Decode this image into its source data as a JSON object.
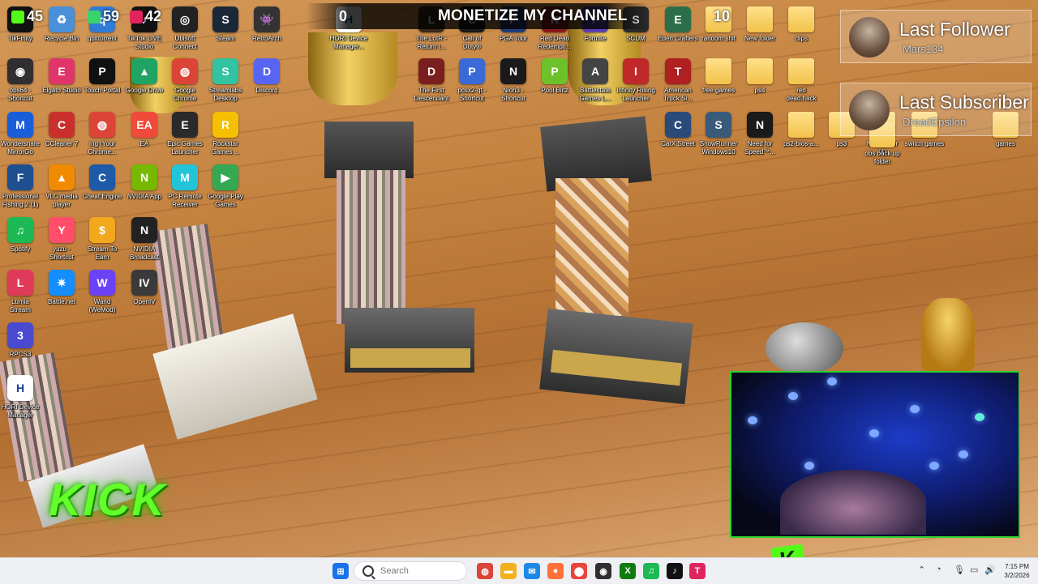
{
  "overlay": {
    "stats": [
      {
        "label": "Kick",
        "value": "45",
        "color": "#53fc18"
      },
      {
        "label": "Viewers",
        "value": "59",
        "color": "#3ad36a"
      },
      {
        "label": "Chat",
        "value": "42",
        "color": "#e0245e"
      }
    ],
    "banner_left_count": "0",
    "banner_title": "MONETIZE MY CHANNEL",
    "banner_right_count": "10",
    "last_follower": {
      "title": "Last Follower",
      "name": "Mars134"
    },
    "last_subscriber": {
      "title": "Last Subscriber",
      "name": "DreadEpsilon"
    },
    "kick_logo": "KICK",
    "kick_badge": "K"
  },
  "desktop": {
    "icons": [
      {
        "id": "tikfinity",
        "label": "TikFinity",
        "label2": "",
        "glyph": "T",
        "color": "#111111"
      },
      {
        "id": "recycle-bin",
        "label": "Recycle Bin",
        "label2": "",
        "glyph": "♻",
        "color": "#4a90d9"
      },
      {
        "id": "qbittorrent",
        "label": "qbittorrent",
        "label2": "",
        "glyph": "q",
        "color": "#2f7bd6"
      },
      {
        "id": "tiktok-live-studio",
        "label": "TikTok LIVE",
        "label2": "Studio",
        "glyph": "♪",
        "color": "#111111"
      },
      {
        "id": "ubisoft-connect",
        "label": "Ubisoft",
        "label2": "Connect",
        "glyph": "◎",
        "color": "#222222"
      },
      {
        "id": "steam",
        "label": "Steam",
        "label2": "",
        "glyph": "S",
        "color": "#1b2838"
      },
      {
        "id": "retroarch",
        "label": "RetroArch",
        "label2": "",
        "glyph": "👾",
        "color": "#333333"
      },
      {
        "id": "obs64",
        "label": "obs64 -",
        "label2": "Shortcut",
        "glyph": "◉",
        "color": "#302e31"
      },
      {
        "id": "elgato-studio",
        "label": "Elgato Studio",
        "label2": "",
        "glyph": "E",
        "color": "#e0356a"
      },
      {
        "id": "touch-portal",
        "label": "Touch Portal",
        "label2": "",
        "glyph": "P",
        "color": "#111111"
      },
      {
        "id": "google-drive",
        "label": "Google Drive",
        "label2": "",
        "glyph": "▲",
        "color": "#1fa463"
      },
      {
        "id": "google-chrome",
        "label": "Google",
        "label2": "Chrome",
        "glyph": "◍",
        "color": "#db4437"
      },
      {
        "id": "streamlabs",
        "label": "Streamlabs",
        "label2": "Desktop",
        "glyph": "S",
        "color": "#31c3a2"
      },
      {
        "id": "discord",
        "label": "Discord",
        "label2": "",
        "glyph": "D",
        "color": "#5865f2"
      },
      {
        "id": "mirrorgo",
        "label": "Wondershare",
        "label2": "MirrorGo",
        "glyph": "M",
        "color": "#1a5dd8"
      },
      {
        "id": "ccleaner",
        "label": "CCleaner 7",
        "label2": "",
        "glyph": "C",
        "color": "#c9302c"
      },
      {
        "id": "ing-chrome",
        "label": "Ing (Your",
        "label2": "Chrome...",
        "glyph": "◍",
        "color": "#db4437"
      },
      {
        "id": "ea",
        "label": "EA",
        "label2": "",
        "glyph": "EA",
        "color": "#f04a3a"
      },
      {
        "id": "epic-games",
        "label": "Epic Games",
        "label2": "Launcher",
        "glyph": "E",
        "color": "#2a2a2a"
      },
      {
        "id": "rockstar",
        "label": "Rockstar",
        "label2": "Games ...",
        "glyph": "R",
        "color": "#f6c000"
      },
      {
        "id": "pro-fishing",
        "label": "Professional",
        "label2": "Fishing 2 (1)",
        "glyph": "F",
        "color": "#1e4f8f"
      },
      {
        "id": "vlc",
        "label": "VLC media",
        "label2": "player",
        "glyph": "▲",
        "color": "#f08a00"
      },
      {
        "id": "cheat-engine",
        "label": "Cheat Engine",
        "label2": "",
        "glyph": "C",
        "color": "#1d5aa8"
      },
      {
        "id": "nvidia-app",
        "label": "NVIDIA App",
        "label2": "",
        "glyph": "N",
        "color": "#76b900"
      },
      {
        "id": "pc-remote",
        "label": "PC Remote",
        "label2": "Receiver",
        "glyph": "M",
        "color": "#23c4d8"
      },
      {
        "id": "google-play-games",
        "label": "Google Play",
        "label2": "Games",
        "glyph": "▶",
        "color": "#34a853"
      },
      {
        "id": "spotify",
        "label": "Spotify",
        "label2": "",
        "glyph": "♫",
        "color": "#1db954"
      },
      {
        "id": "yuzu",
        "label": "yuzu -",
        "label2": "Shortcut",
        "glyph": "Y",
        "color": "#ff4d6a"
      },
      {
        "id": "stream-to-earn",
        "label": "Stream To",
        "label2": "Earn",
        "glyph": "$",
        "color": "#f2a81d"
      },
      {
        "id": "nvidia-broadcast",
        "label": "NVIDIA",
        "label2": "Broadcast",
        "glyph": "N",
        "color": "#222222"
      },
      {
        "id": "lumia-stream",
        "label": "Lumia",
        "label2": "Stream",
        "glyph": "L",
        "color": "#e03a5a"
      },
      {
        "id": "battle-net",
        "label": "Battle.net",
        "label2": "",
        "glyph": "✷",
        "color": "#148eff"
      },
      {
        "id": "wand",
        "label": "Wand",
        "label2": "(WeMod)",
        "glyph": "W",
        "color": "#6b42f5"
      },
      {
        "id": "openiv",
        "label": "OpenIV",
        "label2": "",
        "glyph": "IV",
        "color": "#3a3a3a"
      },
      {
        "id": "rpcs3",
        "label": "RPCS3",
        "label2": "",
        "glyph": "3",
        "color": "#4a4ad0"
      },
      {
        "id": "hori-device-manager",
        "label": "HORI Device",
        "label2": "Manager",
        "glyph": "H",
        "color": "#ffffff"
      },
      {
        "id": "hori-device-manager-2",
        "label": "HORI Device",
        "label2": "Manager...",
        "glyph": "H",
        "color": "#ffffff"
      },
      {
        "id": "lotr",
        "label": "The LotR -",
        "label2": "Return t...",
        "glyph": "L",
        "color": "#3b2a1a"
      },
      {
        "id": "call-of-duty",
        "label": "Call of",
        "label2": "Duty®",
        "glyph": "C",
        "color": "#1a1a1a"
      },
      {
        "id": "pga-tour",
        "label": "PGA Tour",
        "label2": "",
        "glyph": "P",
        "color": "#1e3c78"
      },
      {
        "id": "red-dead-redemption",
        "label": "Red Dead",
        "label2": "Redempti...",
        "glyph": "R",
        "color": "#8b1a1a"
      },
      {
        "id": "fortnite",
        "label": "Fortnite",
        "label2": "",
        "glyph": "F",
        "color": "#5a3fb0"
      },
      {
        "id": "scum",
        "label": "SCUM",
        "label2": "",
        "glyph": "S",
        "color": "#2a2a2a"
      },
      {
        "id": "eden-crafters",
        "label": "Eden Crafters",
        "label2": "",
        "glyph": "E",
        "color": "#2c6e49"
      },
      {
        "id": "random-shit",
        "label": "random shit",
        "label2": "",
        "glyph": "",
        "color": "#f2c24a",
        "folder": true
      },
      {
        "id": "new-folder",
        "label": "New folder",
        "label2": "",
        "glyph": "",
        "color": "#f2c24a",
        "folder": true
      },
      {
        "id": "clips",
        "label": "clips",
        "label2": "",
        "glyph": "",
        "color": "#f2c24a",
        "folder": true
      },
      {
        "id": "first-descendant",
        "label": "The First",
        "label2": "Descendant",
        "glyph": "D",
        "color": "#7a1e1e"
      },
      {
        "id": "pcsx2",
        "label": "pcsx2-qt -",
        "label2": "Shortcut",
        "glyph": "P",
        "color": "#3a6ad8"
      },
      {
        "id": "nioh3",
        "label": "Nioh3 -",
        "label2": "Shortcut",
        "glyph": "N",
        "color": "#1a1a1a"
      },
      {
        "id": "pool-blitz",
        "label": "Pool Blitz",
        "label2": "",
        "glyph": "P",
        "color": "#6dc12a"
      },
      {
        "id": "battlestate",
        "label": "Battlestate",
        "label2": "Games L...",
        "glyph": "A",
        "color": "#444444"
      },
      {
        "id": "infinity-rising",
        "label": "Infinity Rising",
        "label2": "Launcher",
        "glyph": "I",
        "color": "#c0282a"
      },
      {
        "id": "american-truck",
        "label": "American",
        "label2": "Truck Si...",
        "glyph": "T",
        "color": "#b02020"
      },
      {
        "id": "free-games",
        "label": "free games",
        "label2": "",
        "glyph": "",
        "color": "#f2c24a",
        "folder": true
      },
      {
        "id": "ps4",
        "label": "ps4",
        "label2": "",
        "glyph": "",
        "color": "#f2c24a",
        "folder": true
      },
      {
        "id": "red-dead-hack",
        "label": "red",
        "label2": "dead.hack",
        "glyph": "",
        "color": "#f2c24a",
        "folder": true
      },
      {
        "id": "carx-street",
        "label": "CarX Street",
        "label2": "",
        "glyph": "C",
        "color": "#2a4a7a"
      },
      {
        "id": "snowrunner",
        "label": "SnowRunner",
        "label2": "Windows10",
        "glyph": "S",
        "color": "#3a5a7a"
      },
      {
        "id": "need-for-speed",
        "label": "Need for",
        "label2": "Speed™...",
        "glyph": "N",
        "color": "#1a1a1a"
      },
      {
        "id": "ps2-bios",
        "label": "ps2-bios-a...",
        "label2": "",
        "glyph": "",
        "color": "#f2c24a",
        "folder": true
      },
      {
        "id": "ps3",
        "label": "ps3",
        "label2": "",
        "glyph": "",
        "color": "#f2c24a",
        "folder": true
      },
      {
        "id": "new-folder-4",
        "label": "New folder",
        "label2": "(4)",
        "glyph": "",
        "color": "#f2c24a",
        "folder": true
      },
      {
        "id": "switch-games",
        "label": "switch games",
        "label2": "",
        "glyph": "",
        "color": "#f2c24a",
        "folder": true
      },
      {
        "id": "games",
        "label": "games",
        "label2": "",
        "glyph": "",
        "color": "#f2c24a",
        "folder": true
      },
      {
        "id": "obs-backup",
        "label": "obs back up",
        "label2": "folder",
        "glyph": "",
        "color": "#f2c24a",
        "folder": true
      }
    ]
  },
  "taskbar": {
    "search_placeholder": "Search",
    "time": "7:15 PM",
    "date": "3/2/2026",
    "apps": [
      {
        "id": "start",
        "glyph": "⊞",
        "color": "#1a73e8"
      },
      {
        "id": "chrome",
        "glyph": "◍",
        "color": "#db4437"
      },
      {
        "id": "file-explorer",
        "glyph": "▬",
        "color": "#f2b01e"
      },
      {
        "id": "messenger",
        "glyph": "✉",
        "color": "#1e88e5"
      },
      {
        "id": "firefox",
        "glyph": "●",
        "color": "#ff7139"
      },
      {
        "id": "maps",
        "glyph": "⬤",
        "color": "#e8453c"
      },
      {
        "id": "obs",
        "glyph": "◉",
        "color": "#302e31"
      },
      {
        "id": "xbox",
        "glyph": "X",
        "color": "#107c10"
      },
      {
        "id": "spotify",
        "glyph": "♫",
        "color": "#1db954"
      },
      {
        "id": "tiktok",
        "glyph": "♪",
        "color": "#111111"
      },
      {
        "id": "tikfinity",
        "glyph": "T",
        "color": "#e0245e"
      }
    ]
  }
}
